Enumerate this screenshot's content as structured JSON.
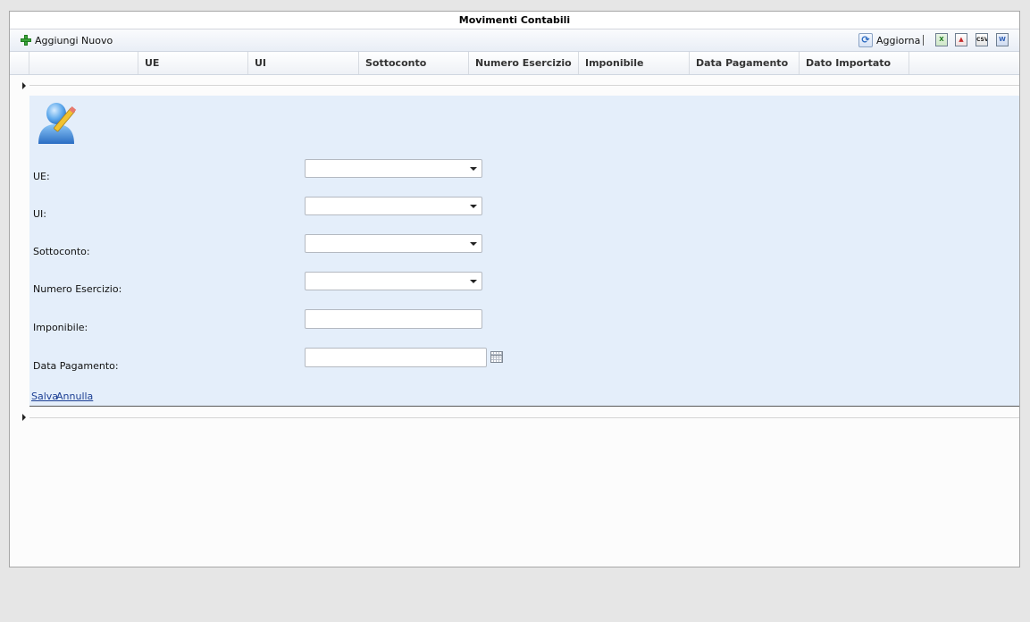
{
  "grid": {
    "title": "Movimenti Contabili",
    "toolbar": {
      "add_label": "Aggiungi Nuovo",
      "refresh_label": "Aggiorna",
      "separator": "|",
      "export_csv_text": "CSV"
    },
    "columns": [
      "UE",
      "UI",
      "Sottoconto",
      "Numero Esercizio",
      "Imponibile",
      "Data Pagamento",
      "Dato Importato"
    ]
  },
  "form": {
    "fields": {
      "ue_label": "UE:",
      "ui_label": "UI:",
      "sottoconto_label": "Sottoconto:",
      "numero_esercizio_label": "Numero Esercizio:",
      "imponibile_label": "Imponibile:",
      "data_pagamento_label": "Data Pagamento:"
    },
    "values": {
      "ue": "",
      "ui": "",
      "sottoconto": "",
      "numero_esercizio": "",
      "imponibile": "",
      "data_pagamento": ""
    },
    "actions": {
      "save_label": "Salva",
      "cancel_label": "Annulla"
    }
  },
  "colors": {
    "background": "#e6e6e6",
    "form_background": "#e4eefa",
    "link": "#1c3f94"
  }
}
